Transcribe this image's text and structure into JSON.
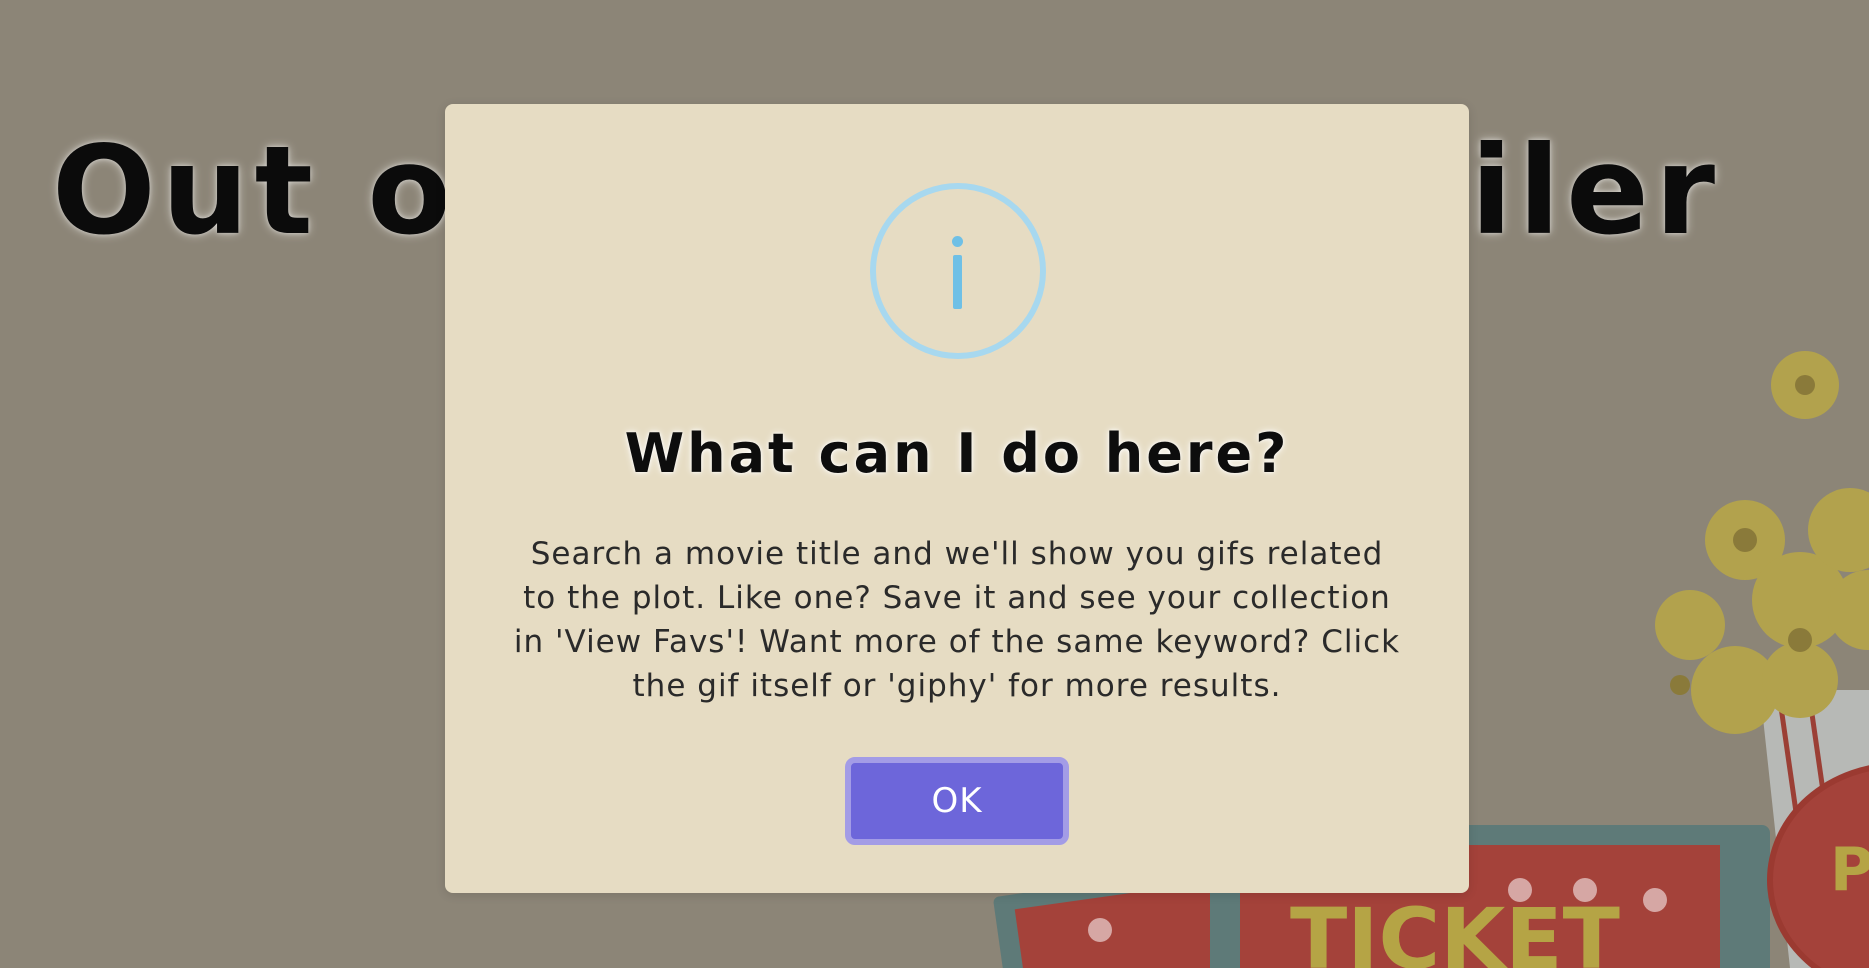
{
  "page": {
    "title": "Out of Context Spoiler"
  },
  "dialog": {
    "icon": "info-icon",
    "title": "What can I do here?",
    "body": "Search a movie title and we'll show you gifs related to the plot. Like one? Save it and see your collection in 'View Favs'! Want more of the same keyword? Click the gif itself or 'giphy' for more results.",
    "ok_label": "OK"
  },
  "decor": {
    "ticket_label": "TICKET",
    "popcorn_sign": "PO CO"
  },
  "colors": {
    "background": "#8c8577",
    "dialog_bg": "#e6dcc3",
    "info_icon": "#6fc0e6",
    "ok_button": "#6d66da"
  }
}
